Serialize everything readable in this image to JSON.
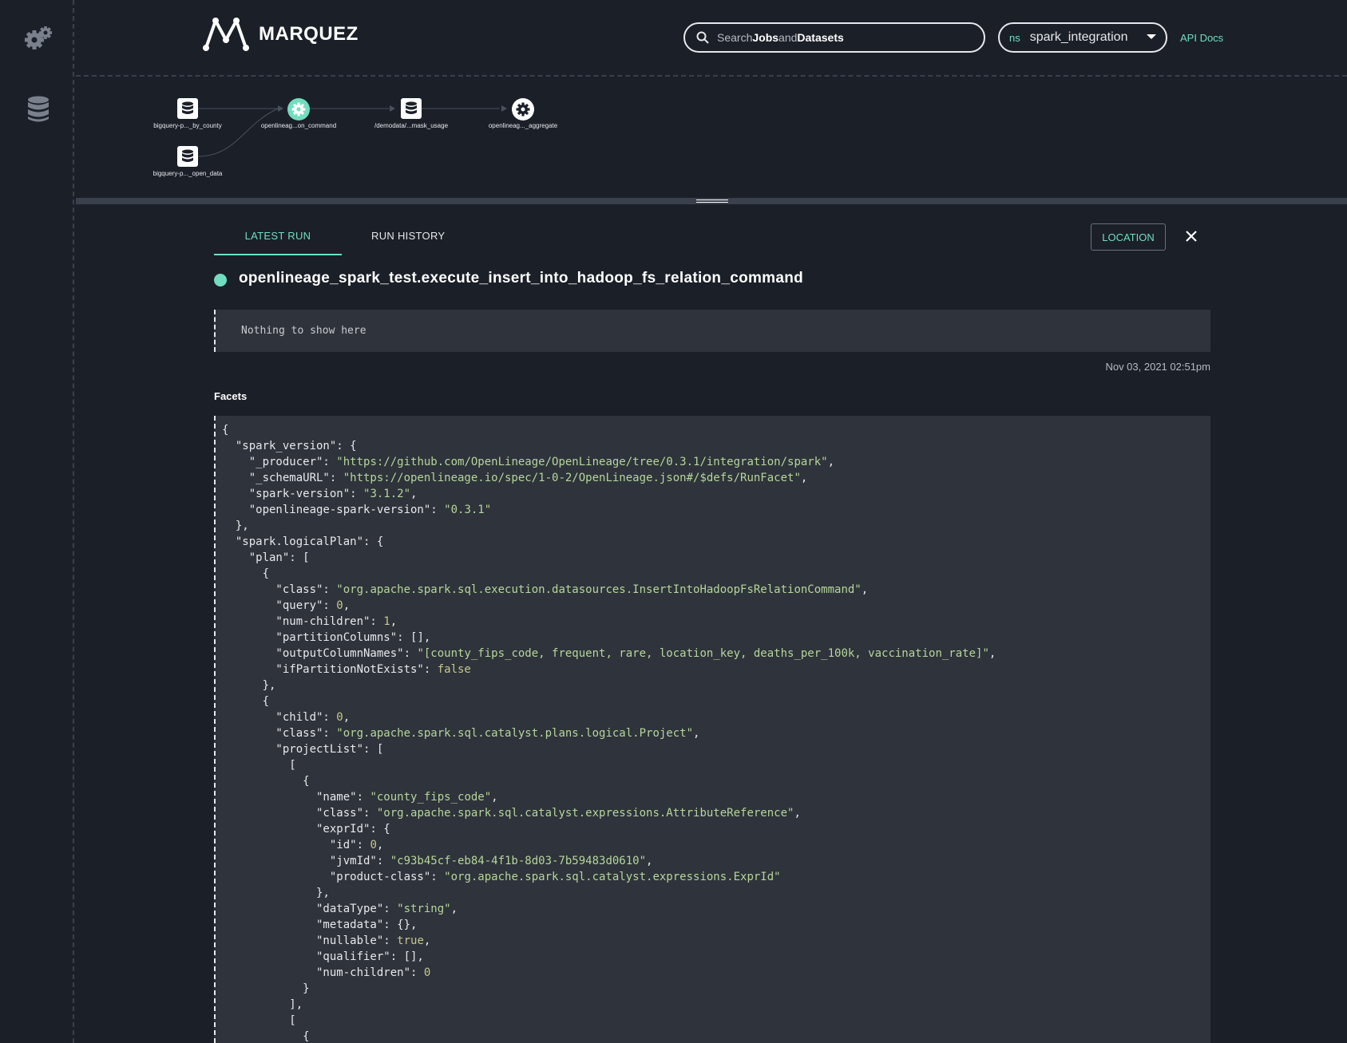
{
  "app": {
    "name": "MARQUEZ"
  },
  "header": {
    "search": {
      "prefix": "Search",
      "jobs": "Jobs",
      "and": "and",
      "datasets": "Datasets"
    },
    "namespace": {
      "label": "ns",
      "value": "spark_integration"
    },
    "api_docs": "API Docs"
  },
  "sidebar": {
    "items": [
      {
        "icon": "gear-icon"
      },
      {
        "icon": "database-icon"
      }
    ]
  },
  "graph": {
    "nodes": [
      {
        "label": "bigquery-p..._by_county",
        "type": "dataset"
      },
      {
        "label": "openlineag...on_command",
        "type": "job",
        "selected": true
      },
      {
        "label": "/demodata/...mask_usage",
        "type": "dataset"
      },
      {
        "label": "openlineag..._aggregate",
        "type": "job"
      },
      {
        "label": "bigquery-p..._open_data",
        "type": "dataset"
      }
    ]
  },
  "tabs": {
    "latest_run": "LATEST RUN",
    "run_history": "RUN HISTORY"
  },
  "location_button": "LOCATION",
  "job": {
    "title": "openlineage_spark_test.execute_insert_into_hadoop_fs_relation_command",
    "status_color": "#71ddbf"
  },
  "empty_message": "Nothing to show here",
  "timestamp": "Nov 03, 2021 02:51pm",
  "facets_label": "Facets",
  "code_lines": [
    {
      "indent": 0,
      "key": "",
      "val": "{",
      "type": "p"
    },
    {
      "indent": 2,
      "key": "\"spark_version\": ",
      "val": "{",
      "type": "p"
    },
    {
      "indent": 4,
      "key": "\"_producer\": ",
      "val": "\"https://github.com/OpenLineage/OpenLineage/tree/0.3.1/integration/spark\"",
      "type": "s",
      "tail": ","
    },
    {
      "indent": 4,
      "key": "\"_schemaURL\": ",
      "val": "\"https://openlineage.io/spec/1-0-2/OpenLineage.json#/$defs/RunFacet\"",
      "type": "s",
      "tail": ","
    },
    {
      "indent": 4,
      "key": "\"spark-version\": ",
      "val": "\"3.1.2\"",
      "type": "s",
      "tail": ","
    },
    {
      "indent": 4,
      "key": "\"openlineage-spark-version\": ",
      "val": "\"0.3.1\"",
      "type": "s"
    },
    {
      "indent": 2,
      "key": "",
      "val": "},",
      "type": "p"
    },
    {
      "indent": 2,
      "key": "\"spark.logicalPlan\": ",
      "val": "{",
      "type": "p"
    },
    {
      "indent": 4,
      "key": "\"plan\": ",
      "val": "[",
      "type": "p"
    },
    {
      "indent": 6,
      "key": "",
      "val": "{",
      "type": "p"
    },
    {
      "indent": 8,
      "key": "\"class\": ",
      "val": "\"org.apache.spark.sql.execution.datasources.InsertIntoHadoopFsRelationCommand\"",
      "type": "s",
      "tail": ","
    },
    {
      "indent": 8,
      "key": "\"query\": ",
      "val": "0",
      "type": "n",
      "tail": ","
    },
    {
      "indent": 8,
      "key": "\"num-children\": ",
      "val": "1",
      "type": "n",
      "tail": ","
    },
    {
      "indent": 8,
      "key": "\"partitionColumns\": ",
      "val": "[],",
      "type": "p"
    },
    {
      "indent": 8,
      "key": "\"outputColumnNames\": ",
      "val": "\"[county_fips_code, frequent, rare, location_key, deaths_per_100k, vaccination_rate]\"",
      "type": "s",
      "tail": ","
    },
    {
      "indent": 8,
      "key": "\"ifPartitionNotExists\": ",
      "val": "false",
      "type": "b"
    },
    {
      "indent": 6,
      "key": "",
      "val": "},",
      "type": "p"
    },
    {
      "indent": 6,
      "key": "",
      "val": "{",
      "type": "p"
    },
    {
      "indent": 8,
      "key": "\"child\": ",
      "val": "0",
      "type": "n",
      "tail": ","
    },
    {
      "indent": 8,
      "key": "\"class\": ",
      "val": "\"org.apache.spark.sql.catalyst.plans.logical.Project\"",
      "type": "s",
      "tail": ","
    },
    {
      "indent": 8,
      "key": "\"projectList\": ",
      "val": "[",
      "type": "p"
    },
    {
      "indent": 10,
      "key": "",
      "val": "[",
      "type": "p"
    },
    {
      "indent": 12,
      "key": "",
      "val": "{",
      "type": "p"
    },
    {
      "indent": 14,
      "key": "\"name\": ",
      "val": "\"county_fips_code\"",
      "type": "s",
      "tail": ","
    },
    {
      "indent": 14,
      "key": "\"class\": ",
      "val": "\"org.apache.spark.sql.catalyst.expressions.AttributeReference\"",
      "type": "s",
      "tail": ","
    },
    {
      "indent": 14,
      "key": "\"exprId\": ",
      "val": "{",
      "type": "p"
    },
    {
      "indent": 16,
      "key": "\"id\": ",
      "val": "0",
      "type": "n",
      "tail": ","
    },
    {
      "indent": 16,
      "key": "\"jvmId\": ",
      "val": "\"c93b45cf-eb84-4f1b-8d03-7b59483d0610\"",
      "type": "s",
      "tail": ","
    },
    {
      "indent": 16,
      "key": "\"product-class\": ",
      "val": "\"org.apache.spark.sql.catalyst.expressions.ExprId\"",
      "type": "s"
    },
    {
      "indent": 14,
      "key": "",
      "val": "},",
      "type": "p"
    },
    {
      "indent": 14,
      "key": "\"dataType\": ",
      "val": "\"string\"",
      "type": "s",
      "tail": ","
    },
    {
      "indent": 14,
      "key": "\"metadata\": ",
      "val": "{},",
      "type": "p"
    },
    {
      "indent": 14,
      "key": "\"nullable\": ",
      "val": "true",
      "type": "b",
      "tail": ","
    },
    {
      "indent": 14,
      "key": "\"qualifier\": ",
      "val": "[],",
      "type": "p"
    },
    {
      "indent": 14,
      "key": "\"num-children\": ",
      "val": "0",
      "type": "n"
    },
    {
      "indent": 12,
      "key": "",
      "val": "}",
      "type": "p"
    },
    {
      "indent": 10,
      "key": "",
      "val": "],",
      "type": "p"
    },
    {
      "indent": 10,
      "key": "",
      "val": "[",
      "type": "p"
    },
    {
      "indent": 12,
      "key": "",
      "val": "{",
      "type": "p"
    }
  ]
}
